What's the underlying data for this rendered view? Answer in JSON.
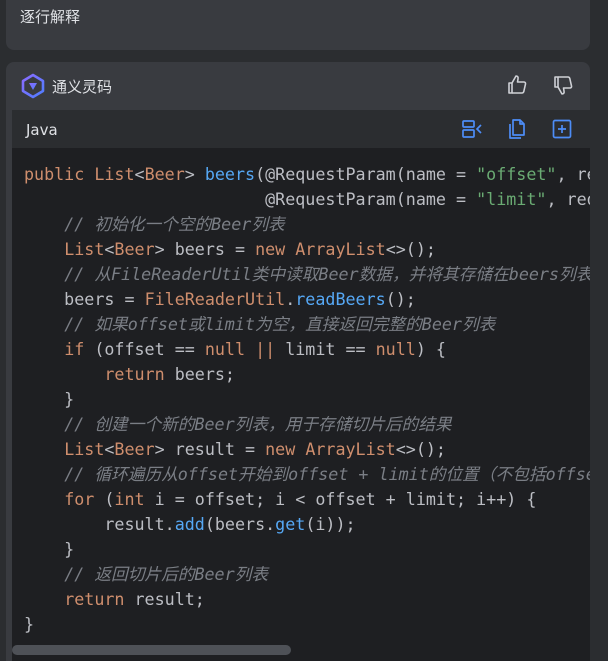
{
  "top_card": {
    "text": "逐行解释"
  },
  "panel": {
    "brand": "通义灵码",
    "language": "Java",
    "icons": {
      "thumb_up": "thumbs-up-icon",
      "thumb_down": "thumbs-down-icon",
      "insert": "insert-at-cursor-icon",
      "copy": "copy-icon",
      "new_file": "new-file-icon"
    },
    "scroll_position_fraction": 0.0
  },
  "code_lines": [
    [
      [
        "kw",
        "public "
      ],
      [
        "ty",
        "List"
      ],
      [
        "",
        "<"
      ],
      [
        "ty",
        "Beer"
      ],
      [
        "",
        "> "
      ],
      [
        "fn",
        "beers"
      ],
      [
        "",
        "(@RequestParam(name = "
      ],
      [
        "str",
        "\"offset\""
      ],
      [
        "",
        ", required = false) Integer offset,"
      ]
    ],
    [
      [
        "",
        "                        @RequestParam(name = "
      ],
      [
        "str",
        "\"limit\""
      ],
      [
        "",
        ", required = false) Integer limit) {"
      ]
    ],
    [
      [
        "",
        "    "
      ],
      [
        "cm",
        "// 初始化一个空的Beer列表"
      ]
    ],
    [
      [
        "",
        "    "
      ],
      [
        "ty",
        "List"
      ],
      [
        "",
        "<"
      ],
      [
        "ty",
        "Beer"
      ],
      [
        "",
        "> beers = "
      ],
      [
        "kw",
        "new "
      ],
      [
        "ty",
        "ArrayList"
      ],
      [
        "",
        "<>();"
      ]
    ],
    [
      [
        "",
        "    "
      ],
      [
        "cm",
        "// 从FileReaderUtil类中读取Beer数据，并将其存储在beers列表中"
      ]
    ],
    [
      [
        "",
        "    beers = "
      ],
      [
        "ty",
        "FileReaderUtil"
      ],
      [
        "",
        "."
      ],
      [
        "fn",
        "readBeers"
      ],
      [
        "",
        "();"
      ]
    ],
    [
      [
        "",
        "    "
      ],
      [
        "cm",
        "// 如果offset或limit为空，直接返回完整的Beer列表"
      ]
    ],
    [
      [
        "",
        "    "
      ],
      [
        "kw",
        "if "
      ],
      [
        "",
        "(offset == "
      ],
      [
        "kw",
        "null "
      ],
      [
        "kw",
        "|| "
      ],
      [
        "",
        "limit == "
      ],
      [
        "kw",
        "null"
      ],
      [
        "",
        ") {"
      ]
    ],
    [
      [
        "",
        "        "
      ],
      [
        "kw",
        "return "
      ],
      [
        "",
        "beers;"
      ]
    ],
    [
      [
        "",
        "    }"
      ]
    ],
    [
      [
        "",
        "    "
      ],
      [
        "cm",
        "// 创建一个新的Beer列表，用于存储切片后的结果"
      ]
    ],
    [
      [
        "",
        "    "
      ],
      [
        "ty",
        "List"
      ],
      [
        "",
        "<"
      ],
      [
        "ty",
        "Beer"
      ],
      [
        "",
        "> result = "
      ],
      [
        "kw",
        "new "
      ],
      [
        "ty",
        "ArrayList"
      ],
      [
        "",
        "<>();"
      ]
    ],
    [
      [
        "",
        "    "
      ],
      [
        "cm",
        "// 循环遍历从offset开始到offset + limit的位置（不包括offset + limit）"
      ]
    ],
    [
      [
        "",
        "    "
      ],
      [
        "kw",
        "for "
      ],
      [
        "",
        "("
      ],
      [
        "kw",
        "int "
      ],
      [
        "",
        "i = offset; i < offset + limit; i++) {"
      ]
    ],
    [
      [
        "",
        "        result."
      ],
      [
        "fn",
        "add"
      ],
      [
        "",
        "(beers."
      ],
      [
        "fn",
        "get"
      ],
      [
        "",
        "(i));"
      ]
    ],
    [
      [
        "",
        "    }"
      ]
    ],
    [
      [
        "",
        "    "
      ],
      [
        "cm",
        "// 返回切片后的Beer列表"
      ]
    ],
    [
      [
        "",
        "    "
      ],
      [
        "kw",
        "return "
      ],
      [
        "",
        "result;"
      ]
    ],
    [
      [
        "",
        "}"
      ]
    ]
  ],
  "colors": {
    "keyword": "#cf8e6d",
    "string": "#6aab73",
    "method": "#56a8f5",
    "comment": "#7a7e85",
    "text": "#bcbec4",
    "accent": "#3574f0"
  }
}
